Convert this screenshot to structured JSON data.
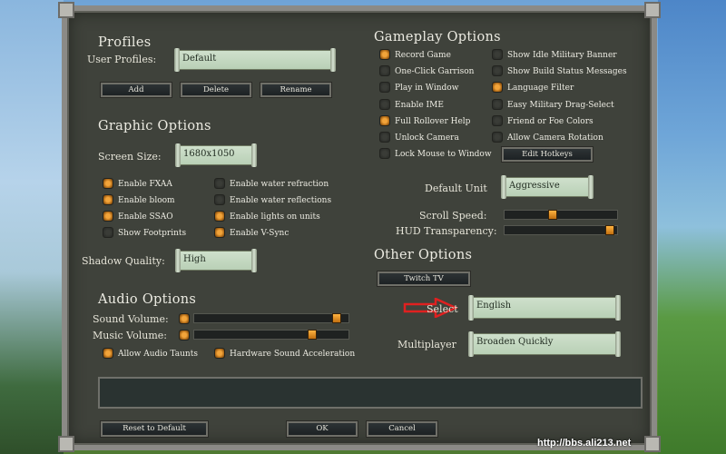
{
  "profiles": {
    "title": "Profiles",
    "user_profiles_label": "User Profiles:",
    "user_profile_value": "Default",
    "buttons": {
      "add": "Add",
      "delete": "Delete",
      "rename": "Rename"
    }
  },
  "graphic": {
    "title": "Graphic Options",
    "screen_size_label": "Screen Size:",
    "screen_size_value": "1680x1050",
    "checks": [
      {
        "label": "Enable FXAA",
        "on": true
      },
      {
        "label": "Enable water refraction",
        "on": false
      },
      {
        "label": "Enable bloom",
        "on": true
      },
      {
        "label": "Enable water reflections",
        "on": false
      },
      {
        "label": "Enable SSAO",
        "on": true
      },
      {
        "label": "Enable lights on units",
        "on": true
      },
      {
        "label": "Show Footprints",
        "on": false
      },
      {
        "label": "Enable V-Sync",
        "on": true
      }
    ],
    "shadow_quality_label": "Shadow Quality:",
    "shadow_quality_value": "High"
  },
  "audio": {
    "title": "Audio Options",
    "sound_volume_label": "Sound Volume:",
    "music_volume_label": "Music Volume:",
    "sound_volume_level": 0.95,
    "music_volume_level": 0.78,
    "allow_taunts_label": "Allow Audio Taunts",
    "hw_accel_label": "Hardware Sound Acceleration"
  },
  "gameplay": {
    "title": "Gameplay Options",
    "checks": [
      {
        "label": "Record Game",
        "on": true
      },
      {
        "label": "Show Idle Military Banner",
        "on": false
      },
      {
        "label": "One-Click Garrison",
        "on": false
      },
      {
        "label": "Show Build Status Messages",
        "on": false
      },
      {
        "label": "Play in Window",
        "on": false
      },
      {
        "label": "Language Filter",
        "on": true
      },
      {
        "label": "Enable IME",
        "on": false
      },
      {
        "label": "Easy Military Drag-Select",
        "on": false
      },
      {
        "label": "Full Rollover Help",
        "on": true
      },
      {
        "label": "Friend or Foe Colors",
        "on": false
      },
      {
        "label": "Unlock Camera",
        "on": false
      },
      {
        "label": "Allow Camera Rotation",
        "on": false
      },
      {
        "label": "Lock Mouse to Window",
        "on": false
      }
    ],
    "edit_hotkeys": "Edit Hotkeys",
    "default_unit_label": "Default Unit",
    "default_unit_value": "Aggressive",
    "scroll_speed_label": "Scroll Speed:",
    "scroll_speed_level": 0.42,
    "hud_transparency_label": "HUD Transparency:",
    "hud_transparency_level": 0.97
  },
  "other": {
    "title": "Other Options",
    "twitch_label": "Twitch TV",
    "select_label": "Select",
    "select_value": "English",
    "multiplayer_label": "Multiplayer",
    "multiplayer_value": "Broaden Quickly"
  },
  "footer": {
    "reset": "Reset to Default",
    "ok": "OK",
    "cancel": "Cancel"
  },
  "watermark": "http://bbs.ali213.net",
  "colors": {
    "accent": "#f2a43a",
    "panel": "#3f423b",
    "field": "#cfe0cc",
    "arrow": "#e02020"
  }
}
